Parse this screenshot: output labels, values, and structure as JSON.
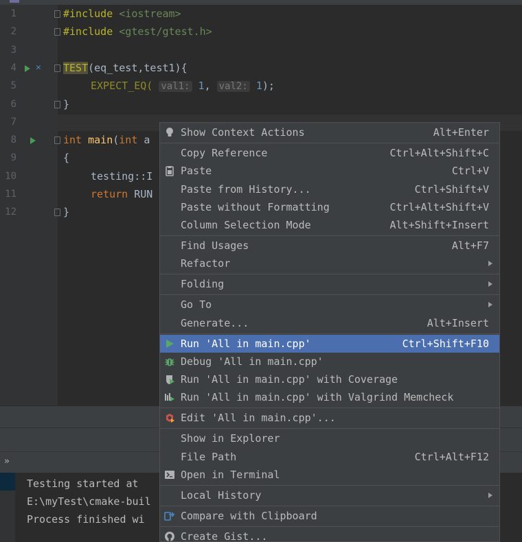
{
  "editor": {
    "line_numbers": [
      "1",
      "2",
      "3",
      "4",
      "5",
      "6",
      "7",
      "8",
      "9",
      "10",
      "11",
      "12"
    ],
    "lines": {
      "l1_directive": "#include",
      "l1_header": "<iostream>",
      "l2_directive": "#include",
      "l2_header": "<gtest/gtest.h>",
      "l4_macro": "TEST",
      "l4_rest": "(eq_test,test1){",
      "l5_macro": "EXPECT_EQ(",
      "l5_hint1": "val1:",
      "l5_val1": "1",
      "l5_comma": ",",
      "l5_hint2": "val2:",
      "l5_val2": "1",
      "l5_end": ");",
      "l6": "}",
      "l8_kw": "int",
      "l8_fn": "main",
      "l8_paren": "(",
      "l8_kw2": "int",
      "l8_rest": " a",
      "l9": "{",
      "l10": "testing::I",
      "l11_kw": "return",
      "l11_rest": " RUN",
      "l12": "}"
    }
  },
  "console": {
    "line1": "Testing started at ",
    "line2": "E:\\myTest\\cmake-buil",
    "line3": "Process finished wi"
  },
  "toolbar": {
    "more": "»"
  },
  "menu": {
    "items": [
      {
        "label": "Show Context Actions",
        "shortcut": "Alt+Enter",
        "icon": "lightbulb-icon"
      },
      {
        "label": "Copy Reference",
        "shortcut": "Ctrl+Alt+Shift+C"
      },
      {
        "label": "Paste",
        "shortcut": "Ctrl+V",
        "icon": "clipboard-icon"
      },
      {
        "label": "Paste from History...",
        "shortcut": "Ctrl+Shift+V"
      },
      {
        "label": "Paste without Formatting",
        "shortcut": "Ctrl+Alt+Shift+V"
      },
      {
        "label": "Column Selection Mode",
        "shortcut": "Alt+Shift+Insert"
      },
      {
        "label": "Find Usages",
        "shortcut": "Alt+F7"
      },
      {
        "label": "Refactor",
        "shortcut": ""
      },
      {
        "label": "Folding",
        "shortcut": ""
      },
      {
        "label": "Go To",
        "shortcut": ""
      },
      {
        "label": "Generate...",
        "shortcut": "Alt+Insert"
      },
      {
        "label": "Run 'All in main.cpp'",
        "shortcut": "Ctrl+Shift+F10",
        "icon": "run-icon"
      },
      {
        "label": "Debug 'All in main.cpp'",
        "shortcut": "",
        "icon": "bug-icon"
      },
      {
        "label": "Run 'All in main.cpp' with Coverage",
        "shortcut": "",
        "icon": "coverage-icon"
      },
      {
        "label": "Run 'All in main.cpp' with Valgrind Memcheck",
        "shortcut": "",
        "icon": "valgrind-icon"
      },
      {
        "label": "Edit 'All in main.cpp'...",
        "shortcut": "",
        "icon": "edit-config-icon"
      },
      {
        "label": "Show in Explorer",
        "shortcut": ""
      },
      {
        "label": "File Path",
        "shortcut": "Ctrl+Alt+F12"
      },
      {
        "label": "Open in Terminal",
        "shortcut": "",
        "icon": "terminal-icon"
      },
      {
        "label": "Local History",
        "shortcut": ""
      },
      {
        "label": "Compare with Clipboard",
        "shortcut": "",
        "icon": "compare-icon"
      },
      {
        "label": "Create Gist...",
        "shortcut": "",
        "icon": "github-icon"
      }
    ]
  },
  "colors": {
    "selection": "#4b6eaf",
    "menu_bg": "#3c3f41",
    "editor_bg": "#2b2b2b",
    "run_green": "#499c54"
  }
}
